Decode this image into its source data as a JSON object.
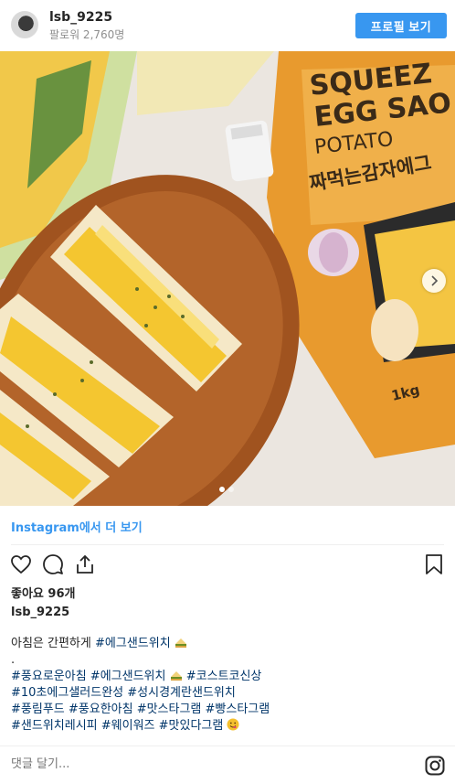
{
  "header": {
    "username": "lsb_9225",
    "followers": "팔로워 2,760명",
    "profile_button": "프로필 보기"
  },
  "post": {
    "view_more": "Instagram에서 더 보기",
    "likes": "좋아요 96개",
    "caption_user": "lsb_9225",
    "caption_lines": [
      "아침은 간편하게 ",
      "#에그샌드위치",
      ".",
      "#풍요로운아침 ",
      "#에그샌드위치",
      "#코스트코신상",
      "#10초에그샐러드완성 ",
      "#성시경계란샌드위치",
      "#풍림푸드 ",
      "#풍요한아침 ",
      "#맛스타그램 ",
      "#빵스타그램",
      "#샌드위치레시피 ",
      "#웨이워즈 ",
      "#맛있다그램"
    ],
    "comment_placeholder": "댓글 달기...",
    "photo_package_text": {
      "line1": "SQUEEZ",
      "line2": "EGG SAO",
      "line3": "POTATO",
      "line4": "짜먹는감자에그",
      "weight": "1kg"
    }
  },
  "carousel": {
    "count": 2,
    "active": 0
  },
  "colors": {
    "accent": "#3897f0",
    "hashtag": "#003569",
    "muted": "#8e8e8e"
  },
  "icons": [
    "heart-icon",
    "comment-icon",
    "share-icon",
    "bookmark-icon",
    "instagram-logo-icon",
    "chevron-right-icon",
    "sandwich-emoji-icon",
    "yum-emoji-icon"
  ]
}
